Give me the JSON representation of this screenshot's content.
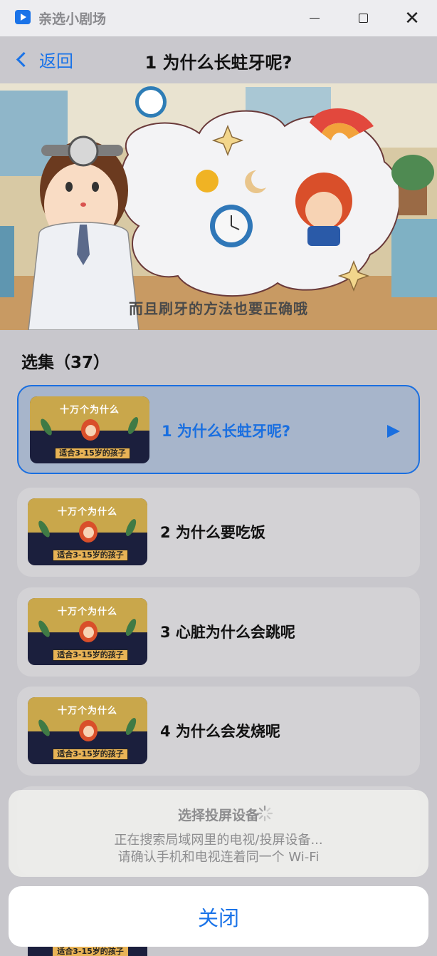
{
  "window": {
    "app_title": "亲选小剧场",
    "icon": "play-app-icon"
  },
  "header": {
    "back_label": "返回",
    "title": "1 为什么长蛀牙呢?"
  },
  "video": {
    "subtitle": "而且刷牙的方法也要正确哦"
  },
  "episode_list": {
    "title": "选集（37）",
    "thumb_title": "十万个为什么",
    "thumb_banner": "适合3-15岁的孩子",
    "episodes": [
      {
        "label": "1 为什么长蛀牙呢?",
        "active": true
      },
      {
        "label": "2 为什么要吃饭",
        "active": false
      },
      {
        "label": "3 心脏为什么会跳呢",
        "active": false
      },
      {
        "label": "4 为什么会发烧呢",
        "active": false
      }
    ]
  },
  "cast_sheet": {
    "title": "选择投屏设备",
    "desc_line1": "正在搜索局域网里的电视/投屏设备...",
    "desc_line2": "请确认手机和电视连着同一个 Wi-Fi",
    "close_label": "关闭"
  },
  "colors": {
    "accent": "#1a73e8",
    "active_card_bg": "#a7b5cb",
    "card_bg": "#d3d2d5",
    "backdrop": "#c8c7cc"
  }
}
